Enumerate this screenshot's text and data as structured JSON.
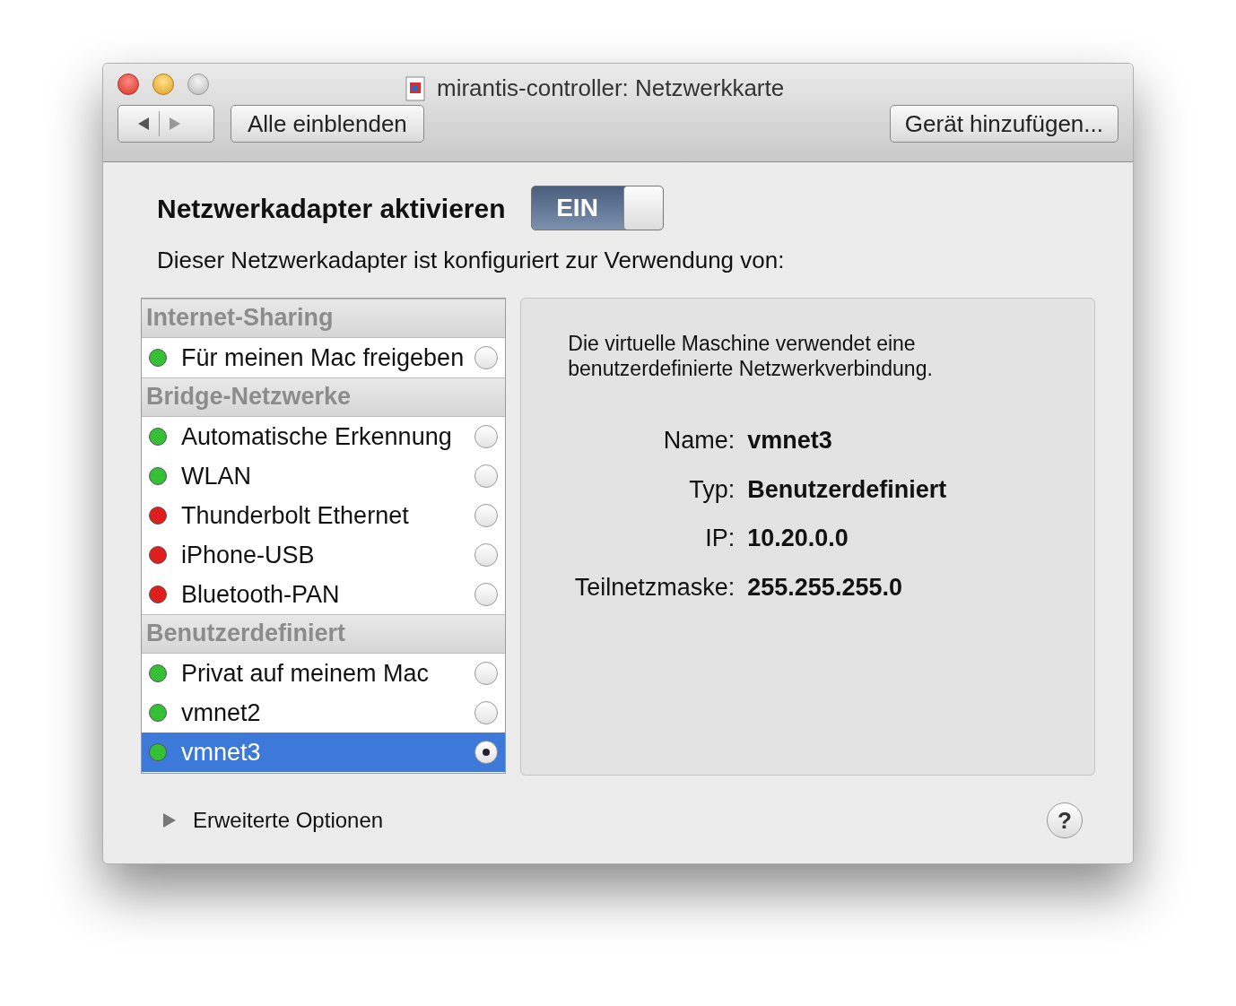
{
  "window": {
    "title": "mirantis-controller: Netzwerkkarte"
  },
  "toolbar": {
    "show_all": "Alle einblenden",
    "add_device": "Gerät hinzufügen..."
  },
  "adapter": {
    "label": "Netzwerkadapter aktivieren",
    "toggle": {
      "text": "EIN",
      "on": true
    }
  },
  "description": "Dieser Netzwerkadapter ist konfiguriert zur Verwendung von:",
  "groups": [
    {
      "title": "Internet-Sharing",
      "items": [
        {
          "name": "Für meinen Mac freigeben",
          "color": "#35c035",
          "selected": false
        }
      ]
    },
    {
      "title": "Bridge-Netzwerke",
      "items": [
        {
          "name": "Automatische Erkennung",
          "color": "#35c035",
          "selected": false
        },
        {
          "name": "WLAN",
          "color": "#35c035",
          "selected": false
        },
        {
          "name": "Thunderbolt Ethernet",
          "color": "#e01e1e",
          "selected": false
        },
        {
          "name": "iPhone-USB",
          "color": "#e01e1e",
          "selected": false
        },
        {
          "name": "Bluetooth-PAN",
          "color": "#e01e1e",
          "selected": false
        }
      ]
    },
    {
      "title": "Benutzerdefiniert",
      "items": [
        {
          "name": "Privat auf meinem Mac",
          "color": "#35c035",
          "selected": false
        },
        {
          "name": "vmnet2",
          "color": "#35c035",
          "selected": false
        },
        {
          "name": "vmnet3",
          "color": "#35c035",
          "selected": true
        }
      ]
    }
  ],
  "details": {
    "note": "Die virtuelle Maschine verwendet eine benutzerdefinierte Netzwerkverbindung.",
    "fields": [
      {
        "label": "Name:",
        "value": "vmnet3"
      },
      {
        "label": "Typ:",
        "value": "Benutzerdefiniert"
      },
      {
        "label": "IP:",
        "value": "10.20.0.0"
      },
      {
        "label": "Teilnetzmaske:",
        "value": "255.255.255.0"
      }
    ]
  },
  "advanced": {
    "label": "Erweiterte Optionen",
    "expanded": false
  },
  "help": "?"
}
